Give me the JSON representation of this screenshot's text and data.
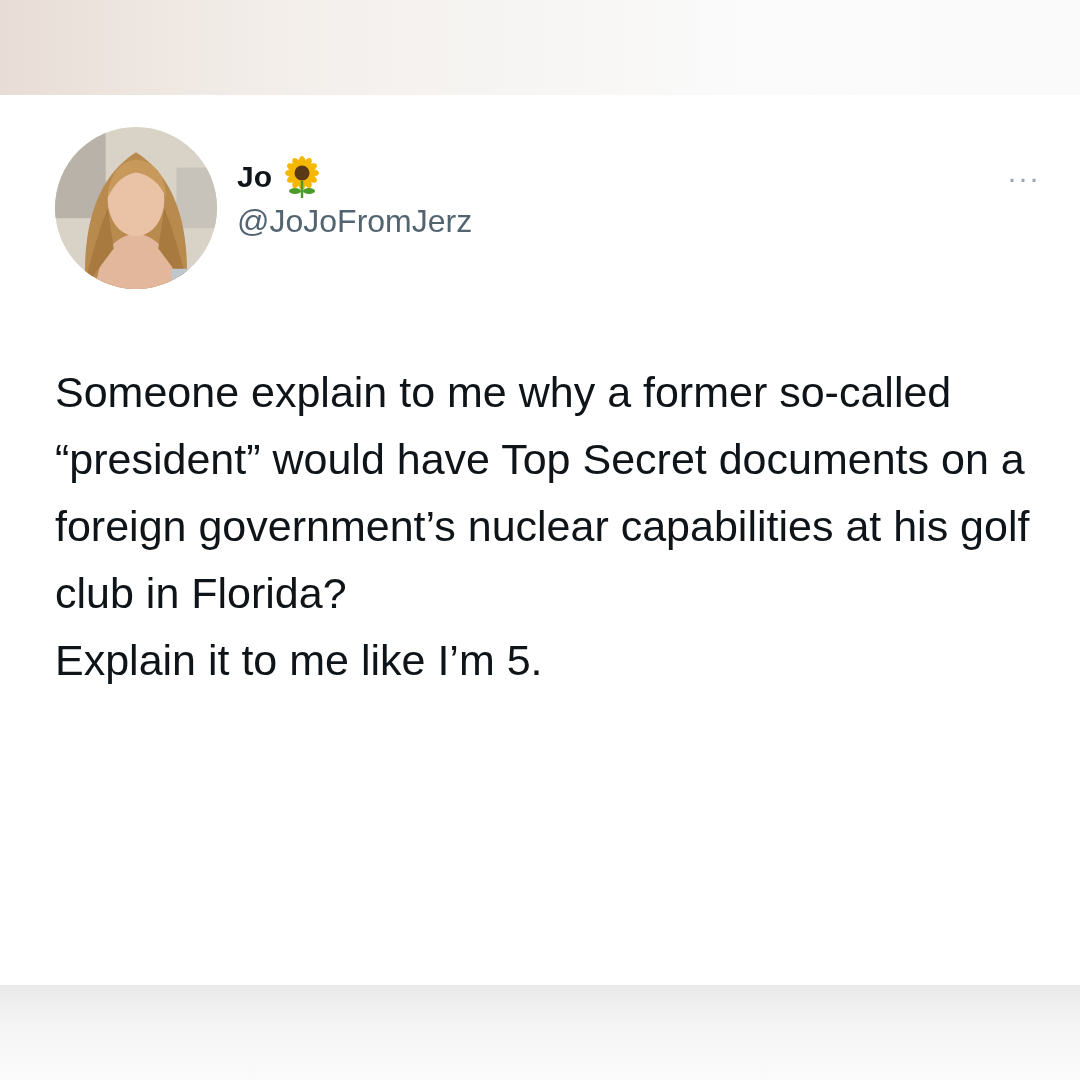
{
  "tweet": {
    "name": "Jo",
    "handle": "@JoJoFromJerz",
    "more": "···",
    "paragraphs": [
      "Someone explain to me why a former so-called “president” would have Top Secret documents on a foreign government’s nuclear capabilities at his golf club in Florida?",
      "Explain it to me like I’m 5."
    ]
  }
}
